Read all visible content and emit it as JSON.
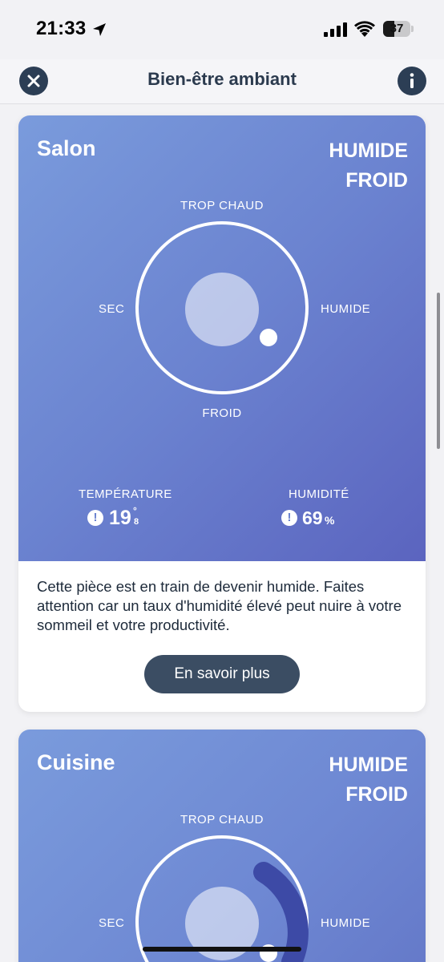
{
  "status_bar": {
    "time": "21:33",
    "battery": "37",
    "icons": [
      "location-arrow-icon",
      "signal-icon",
      "wifi-icon",
      "battery-icon"
    ]
  },
  "nav": {
    "title": "Bien-être ambiant",
    "close_icon": "close-icon",
    "info_icon": "info-icon"
  },
  "rooms": [
    {
      "name": "Salon",
      "status": [
        "HUMIDE",
        "FROID"
      ],
      "axes": {
        "top": "TROP CHAUD",
        "bottom": "FROID",
        "left": "SEC",
        "right": "HUMIDE"
      },
      "temperature": {
        "label": "TEMPÉRATURE",
        "integer": "19",
        "decimal": "8",
        "degree": "°"
      },
      "humidity": {
        "label": "HUMIDITÉ",
        "value": "69",
        "unit": "%"
      },
      "description": "Cette pièce est en train de devenir humide. Faites attention car un taux d'humidité élevé peut nuire à votre sommeil et votre productivité.",
      "button": "En savoir plus"
    },
    {
      "name": "Cuisine",
      "status": [
        "HUMIDE",
        "FROID"
      ],
      "axes": {
        "top": "TROP CHAUD",
        "left": "SEC",
        "right": "HUMIDE"
      }
    }
  ],
  "colors": {
    "card_gradient_start": "#7a9bdc",
    "card_gradient_end": "#5b64bf",
    "button_bg": "#3b4d63",
    "nav_icon_bg": "#2c3e55"
  }
}
